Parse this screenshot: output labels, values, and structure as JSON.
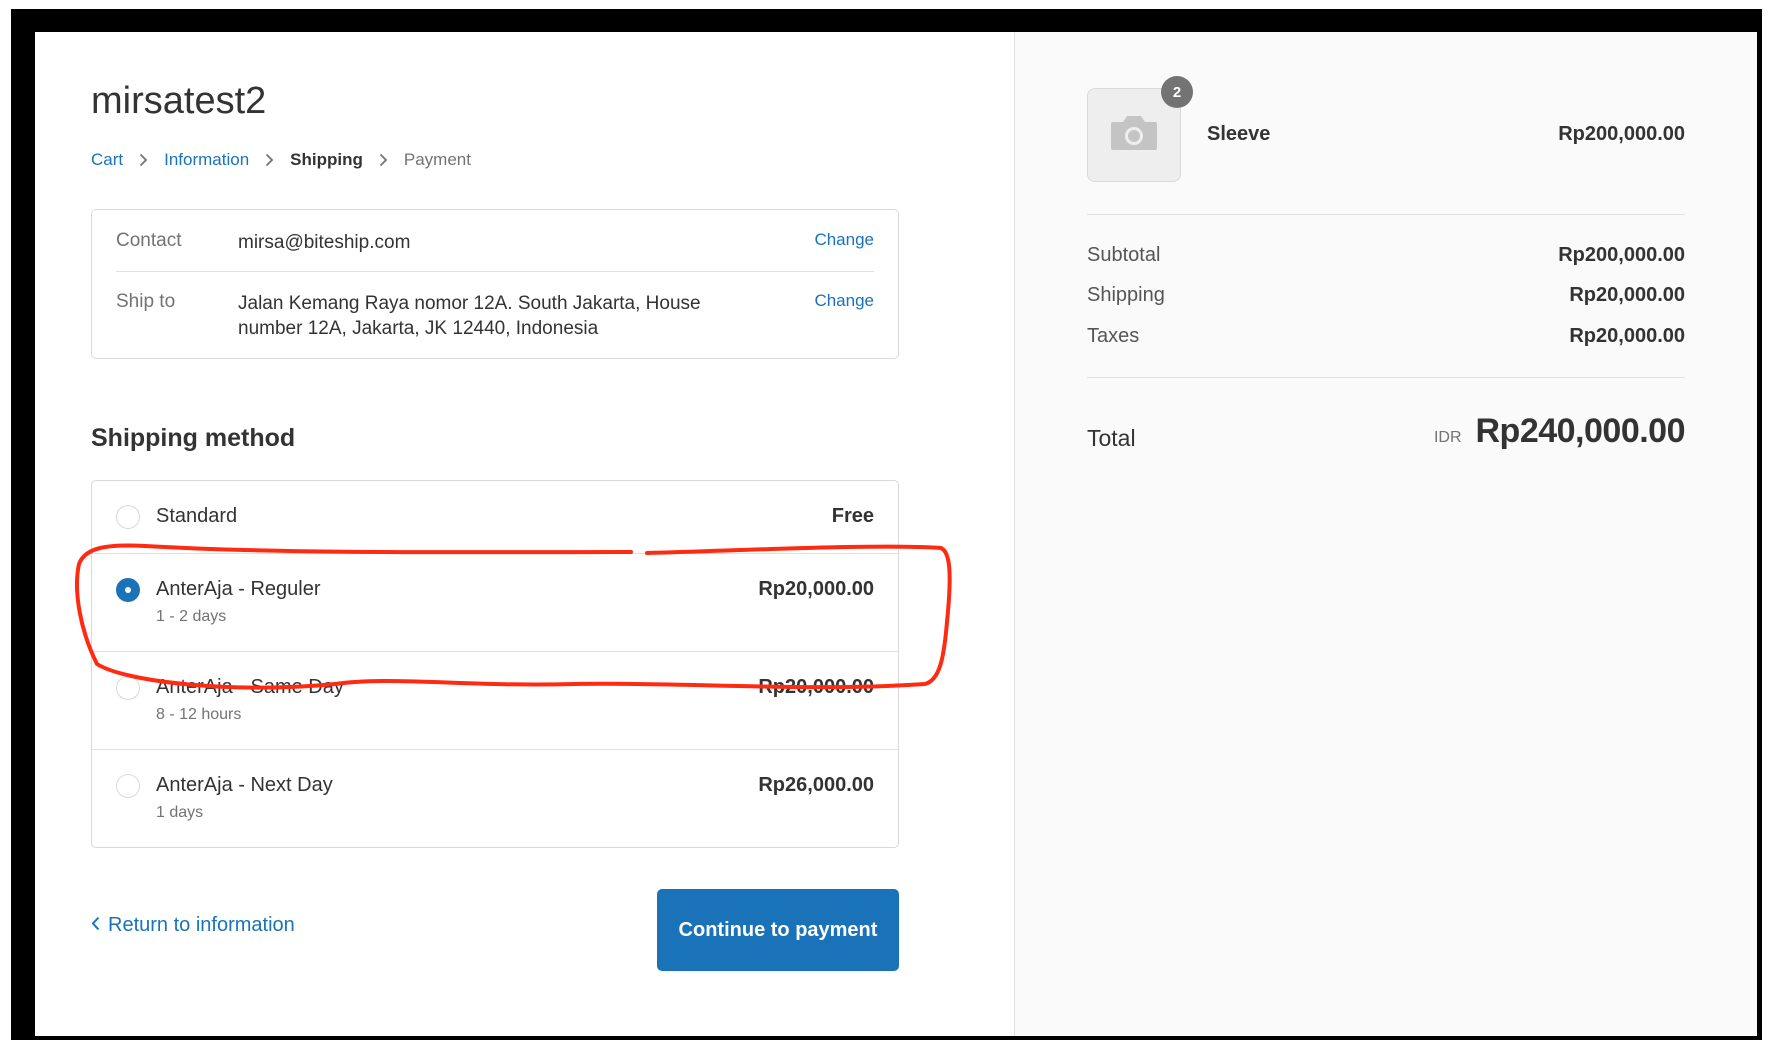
{
  "shop": {
    "name": "mirsatest2"
  },
  "breadcrumb": {
    "cart": "Cart",
    "information": "Information",
    "shipping": "Shipping",
    "payment": "Payment"
  },
  "review": {
    "contact_label": "Contact",
    "contact_value": "mirsa@biteship.com",
    "contact_change": "Change",
    "ship_to_label": "Ship to",
    "ship_to_value": "Jalan Kemang Raya nomor 12A. South Jakarta, House number 12A, Jakarta, JK 12440, Indonesia",
    "ship_to_change": "Change"
  },
  "shipping_method": {
    "title": "Shipping method",
    "options": [
      {
        "name": "Standard",
        "detail": "",
        "price": "Free",
        "selected": false
      },
      {
        "name": "AnterAja - Reguler",
        "detail": "1 - 2 days",
        "price": "Rp20,000.00",
        "selected": true
      },
      {
        "name": "AnterAja - Same Day",
        "detail": "8 - 12 hours",
        "price": "Rp20,000.00",
        "selected": false
      },
      {
        "name": "AnterAja - Next Day",
        "detail": "1 days",
        "price": "Rp26,000.00",
        "selected": false
      }
    ]
  },
  "actions": {
    "return_label": "Return to information",
    "continue_label": "Continue to payment"
  },
  "summary": {
    "product": {
      "name": "Sleeve",
      "quantity": "2",
      "price": "Rp200,000.00",
      "image_icon": "camera-icon"
    },
    "subtotal_label": "Subtotal",
    "subtotal_value": "Rp200,000.00",
    "shipping_label": "Shipping",
    "shipping_value": "Rp20,000.00",
    "taxes_label": "Taxes",
    "taxes_value": "Rp20,000.00",
    "total_label": "Total",
    "total_currency": "IDR",
    "total_value": "Rp240,000.00"
  },
  "colors": {
    "accent": "#1a73b8",
    "annotation": "#ff2a12",
    "frame": "#000000"
  }
}
